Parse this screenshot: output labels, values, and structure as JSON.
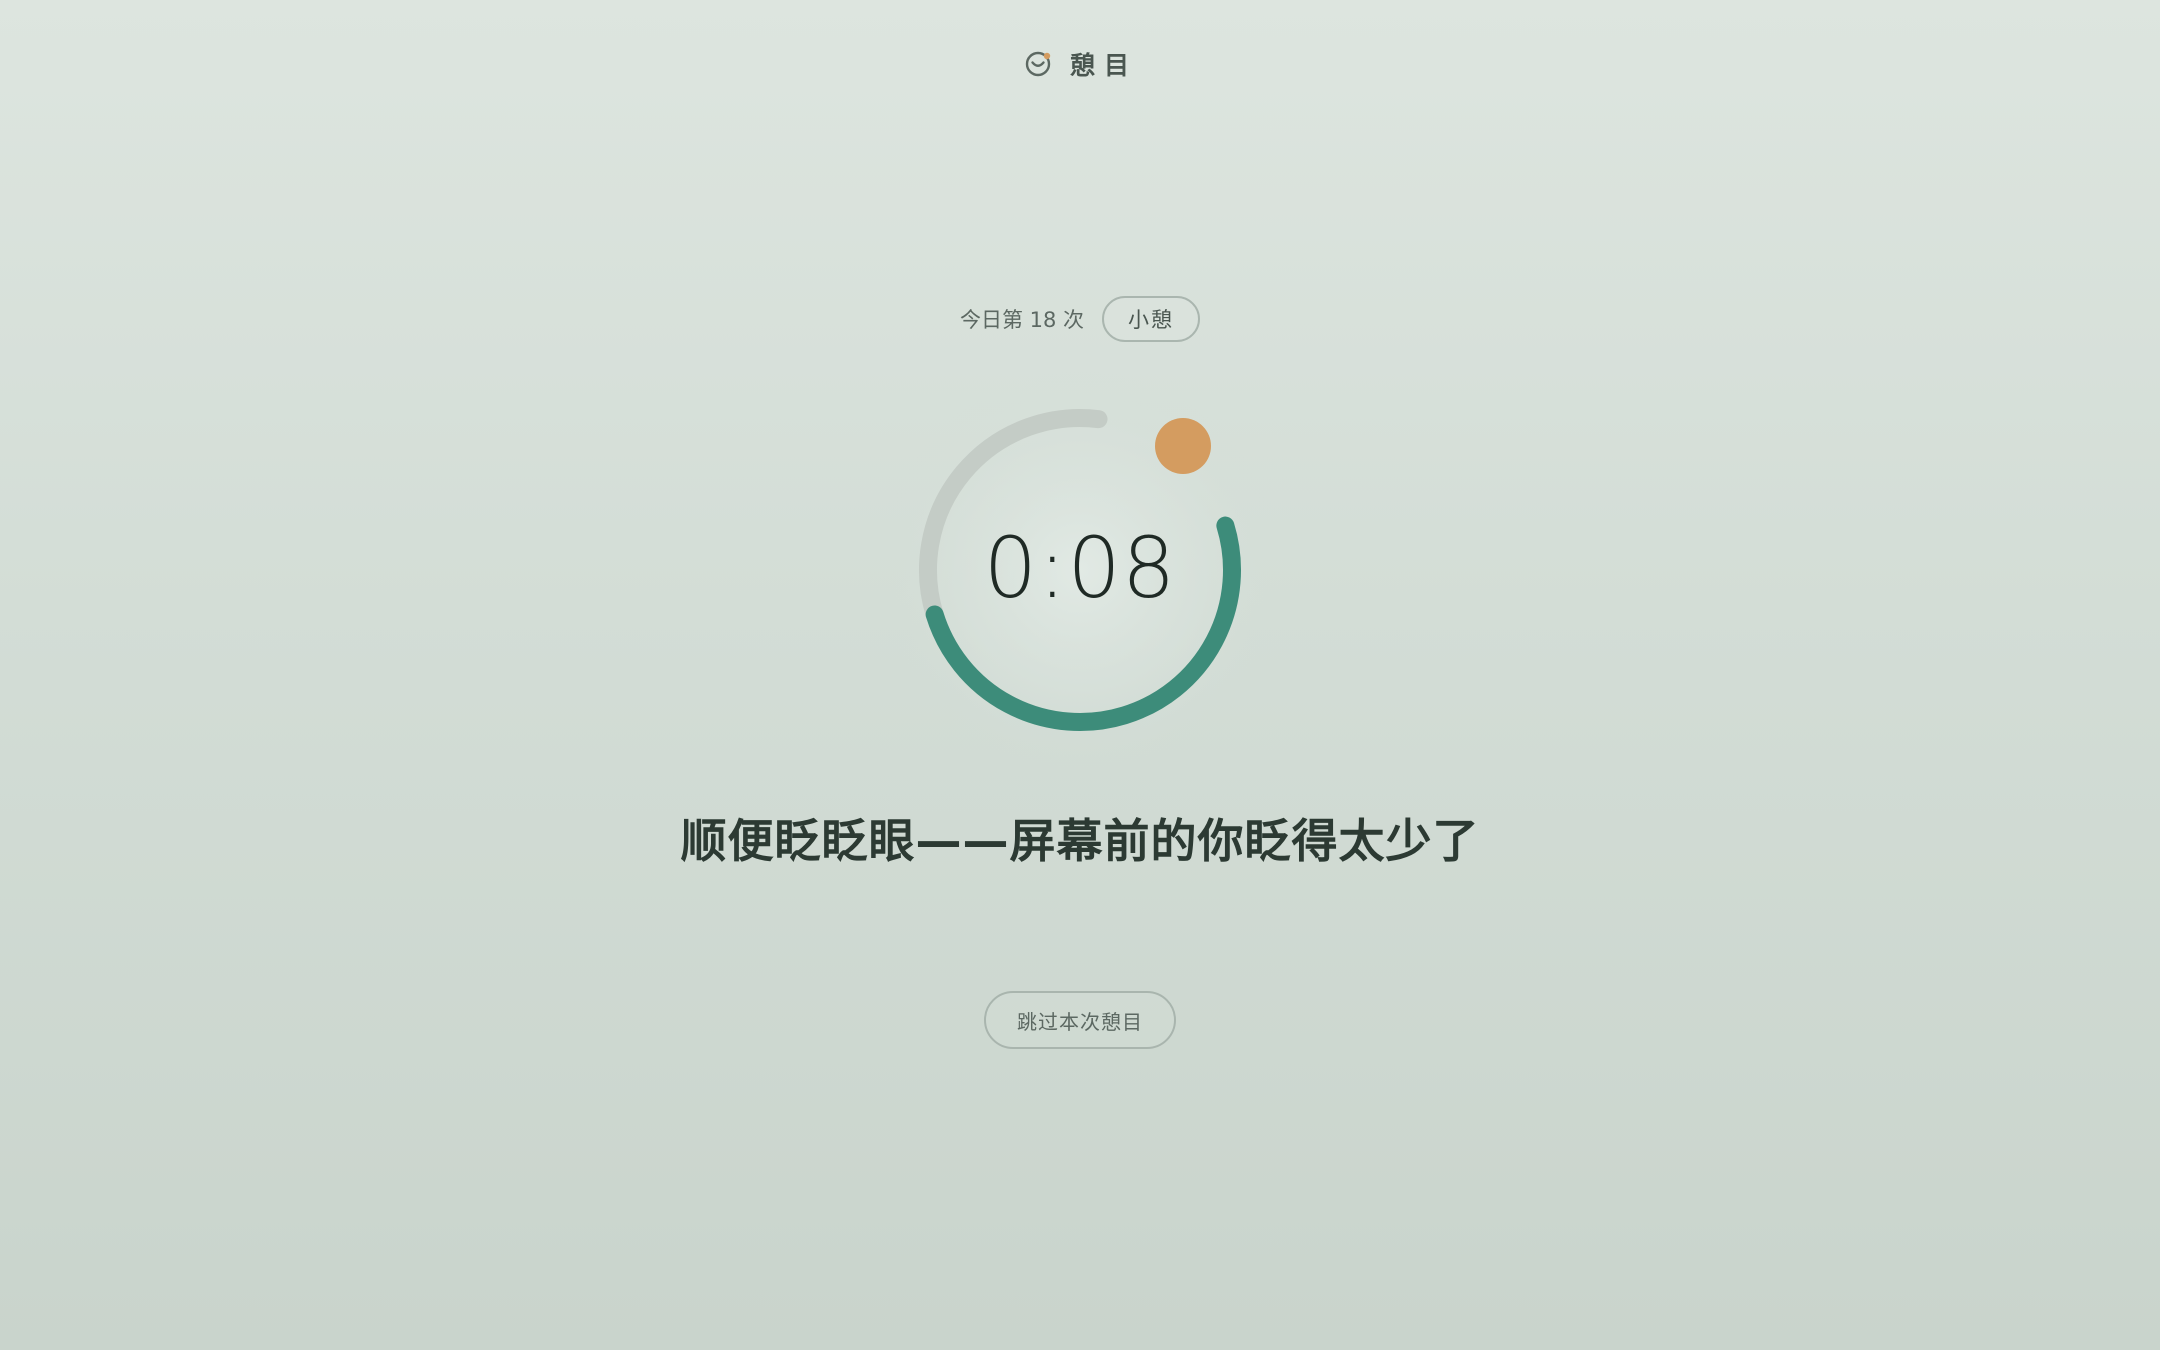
{
  "app": {
    "title": "憩目",
    "icon": "smile-eye-logo-icon"
  },
  "session": {
    "count_label": "今日第 18 次",
    "mode_label": "小憩"
  },
  "timer": {
    "display": "0:08",
    "progress_fraction": 0.38
  },
  "message": "顺便眨眨眼——屏幕前的你眨得太少了",
  "actions": {
    "skip_label": "跳过本次憩目"
  },
  "colors": {
    "accent": "#3d8c7a",
    "track": "#c4ccc6",
    "sun": "#d49c60",
    "text_dark": "#1f2a25"
  }
}
